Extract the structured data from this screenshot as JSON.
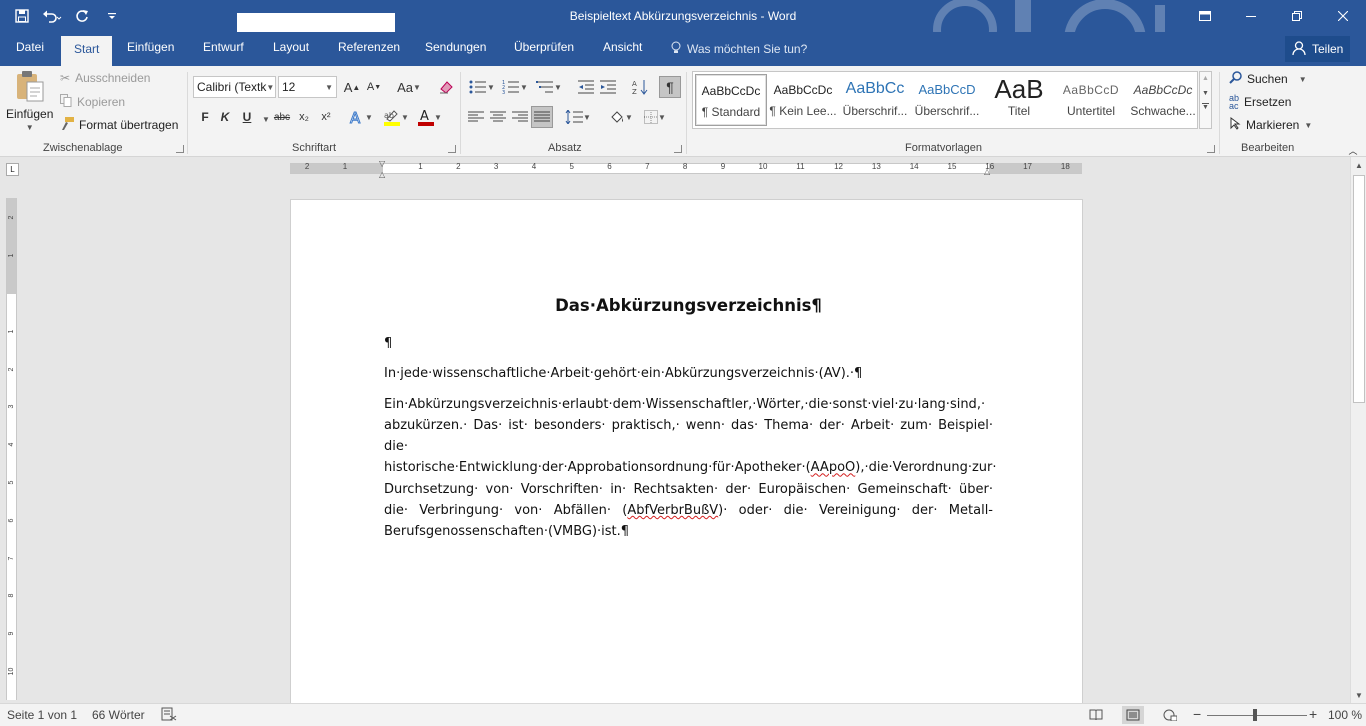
{
  "window": {
    "title": "Beispieltext Abkürzungsverzeichnis  -  Word",
    "controls": [
      "minimize-icon",
      "restore-icon",
      "close-icon"
    ]
  },
  "qat": {
    "icons": [
      "save-icon",
      "undo-icon",
      "redo-icon",
      "customize-icon"
    ]
  },
  "tabs": [
    "Datei",
    "Start",
    "Einfügen",
    "Entwurf",
    "Layout",
    "Referenzen",
    "Sendungen",
    "Überprüfen",
    "Ansicht"
  ],
  "active_tab": "Start",
  "tellme": "Was möchten Sie tun?",
  "share": "Teilen",
  "clipboard": {
    "label": "Zwischenablage",
    "paste": "Einfügen",
    "cut": "Ausschneiden",
    "copy": "Kopieren",
    "format_painter": "Format übertragen"
  },
  "font": {
    "label": "Schriftart",
    "name": "Calibri (Textk",
    "size": "12",
    "bold": "F",
    "italic": "K",
    "underline": "U",
    "strike": "abc",
    "sub": "x₂",
    "sup": "x²",
    "grow": "A",
    "shrink": "A",
    "case": "Aa"
  },
  "paragraph": {
    "label": "Absatz"
  },
  "styles": {
    "label": "Formatvorlagen",
    "items": [
      {
        "preview": "AaBbCcDc",
        "name": "¶ Standard"
      },
      {
        "preview": "AaBbCcDc",
        "name": "¶ Kein Lee..."
      },
      {
        "preview": "AaBbCc",
        "name": "Überschrif..."
      },
      {
        "preview": "AaBbCcD",
        "name": "Überschrif..."
      },
      {
        "preview": "AaB",
        "name": "Titel"
      },
      {
        "preview": "AaBbCcD",
        "name": "Untertitel"
      },
      {
        "preview": "AaBbCcDc",
        "name": "Schwache..."
      }
    ]
  },
  "editing": {
    "label": "Bearbeiten",
    "find": "Suchen",
    "replace": "Ersetzen",
    "select": "Markieren"
  },
  "ruler": {
    "numbers": [
      "2",
      "1",
      "1",
      "2",
      "3",
      "4",
      "5",
      "6",
      "7",
      "8",
      "9",
      "10",
      "11",
      "12",
      "13",
      "14",
      "15",
      "16",
      "17",
      "18"
    ],
    "vnumbers": [
      "2",
      "1",
      "1",
      "2",
      "3",
      "4",
      "5",
      "6",
      "7",
      "8",
      "9",
      "10"
    ]
  },
  "document": {
    "heading": "Das·Abkürzungsverzeichnis¶",
    "empty": "¶",
    "p1": "In·jede·wissenschaftliche·Arbeit·gehört·ein·Abkürzungsverzeichnis·(AV).·¶",
    "p2a": "Ein·Abkürzungsverzeichnis·erlaubt·dem·Wissenschaftler,·Wörter,·die·sonst·viel·zu·lang·sind,· abzukürzen.· Das· ist· besonders· praktisch,· wenn· das· Thema· der· Arbeit· zum· Beispiel· die· historische·Entwicklung·der·Approbationsordnung·für·Apotheker·(",
    "p2b": "AApoO",
    "p2c": "),·die·Verordnung·zur· Durchsetzung· von· Vorschriften· in· Rechtsakten· der· Europäischen· Gemeinschaft· über· die· Verbringung· von· Abfällen· (",
    "p2d": "AbfVerbrBußV",
    "p2e": ")· oder· die· Vereinigung· der· Metall- Berufsgenossenschaften·(VMBG)·ist.¶"
  },
  "status": {
    "page": "Seite 1 von 1",
    "words": "66 Wörter",
    "zoom": "100 %",
    "zoom_value": 1.0
  }
}
